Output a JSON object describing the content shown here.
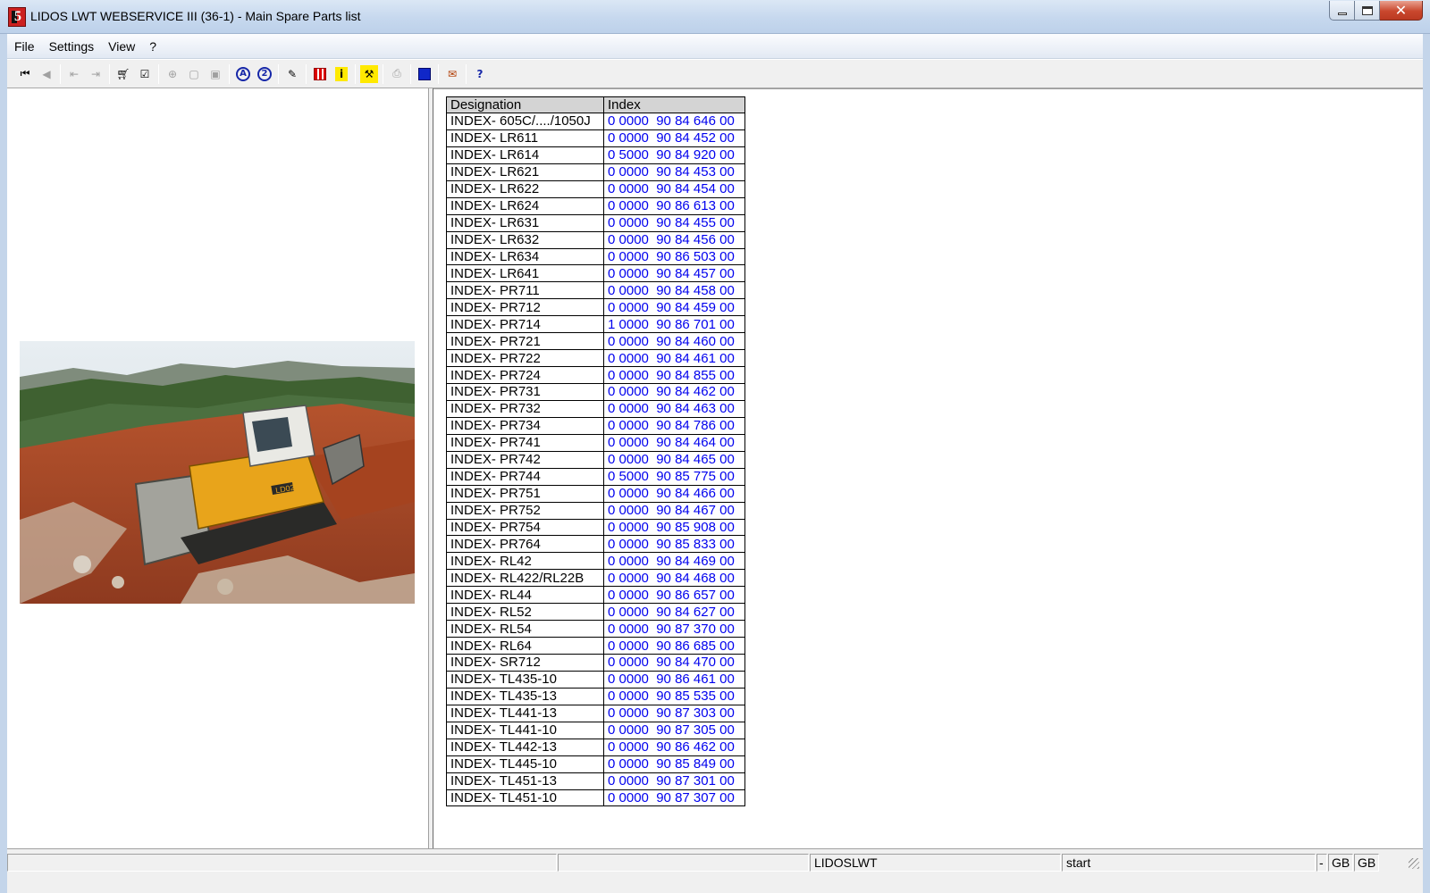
{
  "window": {
    "title": "LIDOS LWT WEBSERVICE III (36-1) - Main Spare Parts list",
    "icon_letter": "5"
  },
  "menu": [
    "File",
    "Settings",
    "View",
    "?"
  ],
  "toolbar": {
    "icons": [
      "first-record-icon",
      "previous-record-icon",
      "back-icon",
      "forward-icon",
      "cart-icon",
      "order-list-icon",
      "zoom-icon",
      "page-icon",
      "page-copy-icon",
      "search-a-icon",
      "search-2-icon",
      "edit-icon",
      "grid-icon",
      "info-icon",
      "tools-icon",
      "print-icon",
      "blue-square-icon",
      "stamp-icon",
      "help-icon"
    ]
  },
  "table": {
    "headers": [
      "Designation",
      "Index"
    ],
    "rows": [
      [
        "INDEX- 605C/..../1050J",
        "0 0000  90 84 646 00"
      ],
      [
        "INDEX- LR611",
        "0 0000  90 84 452 00"
      ],
      [
        "INDEX- LR614",
        "0 5000  90 84 920 00"
      ],
      [
        "INDEX- LR621",
        "0 0000  90 84 453 00"
      ],
      [
        "INDEX- LR622",
        "0 0000  90 84 454 00"
      ],
      [
        "INDEX- LR624",
        "0 0000  90 86 613 00"
      ],
      [
        "INDEX- LR631",
        "0 0000  90 84 455 00"
      ],
      [
        "INDEX- LR632",
        "0 0000  90 84 456 00"
      ],
      [
        "INDEX- LR634",
        "0 0000  90 86 503 00"
      ],
      [
        "INDEX- LR641",
        "0 0000  90 84 457 00"
      ],
      [
        "INDEX- PR711",
        "0 0000  90 84 458 00"
      ],
      [
        "INDEX- PR712",
        "0 0000  90 84 459 00"
      ],
      [
        "INDEX- PR714",
        "1 0000  90 86 701 00"
      ],
      [
        "INDEX- PR721",
        "0 0000  90 84 460 00"
      ],
      [
        "INDEX- PR722",
        "0 0000  90 84 461 00"
      ],
      [
        "INDEX- PR724",
        "0 0000  90 84 855 00"
      ],
      [
        "INDEX- PR731",
        "0 0000  90 84 462 00"
      ],
      [
        "INDEX- PR732",
        "0 0000  90 84 463 00"
      ],
      [
        "INDEX- PR734",
        "0 0000  90 84 786 00"
      ],
      [
        "INDEX- PR741",
        "0 0000  90 84 464 00"
      ],
      [
        "INDEX- PR742",
        "0 0000  90 84 465 00"
      ],
      [
        "INDEX- PR744",
        "0 5000  90 85 775 00"
      ],
      [
        "INDEX- PR751",
        "0 0000  90 84 466 00"
      ],
      [
        "INDEX- PR752",
        "0 0000  90 84 467 00"
      ],
      [
        "INDEX- PR754",
        "0 0000  90 85 908 00"
      ],
      [
        "INDEX- PR764",
        "0 0000  90 85 833 00"
      ],
      [
        "INDEX- RL42",
        "0 0000  90 84 469 00"
      ],
      [
        "INDEX- RL422/RL22B",
        "0 0000  90 84 468 00"
      ],
      [
        "INDEX- RL44",
        "0 0000  90 86 657 00"
      ],
      [
        "INDEX- RL52",
        "0 0000  90 84 627 00"
      ],
      [
        "INDEX- RL54",
        "0 0000  90 87 370 00"
      ],
      [
        "INDEX- RL64",
        "0 0000  90 86 685 00"
      ],
      [
        "INDEX- SR712",
        "0 0000  90 84 470 00"
      ],
      [
        "INDEX- TL435-10",
        "0 0000  90 86 461 00"
      ],
      [
        "INDEX- TL435-13",
        "0 0000  90 85 535 00"
      ],
      [
        "INDEX- TL441-13",
        "0 0000  90 87 303 00"
      ],
      [
        "INDEX- TL441-10",
        "0 0000  90 87 305 00"
      ],
      [
        "INDEX- TL442-13",
        "0 0000  90 86 462 00"
      ],
      [
        "INDEX- TL445-10",
        "0 0000  90 85 849 00"
      ],
      [
        "INDEX- TL451-13",
        "0 0000  90 87 301 00"
      ],
      [
        "INDEX- TL451-10",
        "0 0000  90 87 307 00"
      ]
    ]
  },
  "photo": {
    "machine_label": "LD02"
  },
  "statusbar": {
    "user": "LIDOSLWT",
    "status": "start",
    "dash": "-",
    "lang1": "GB",
    "lang2": "GB"
  },
  "colors": {
    "index_link": "#0000ee",
    "header_bg": "#d4d4d4"
  }
}
